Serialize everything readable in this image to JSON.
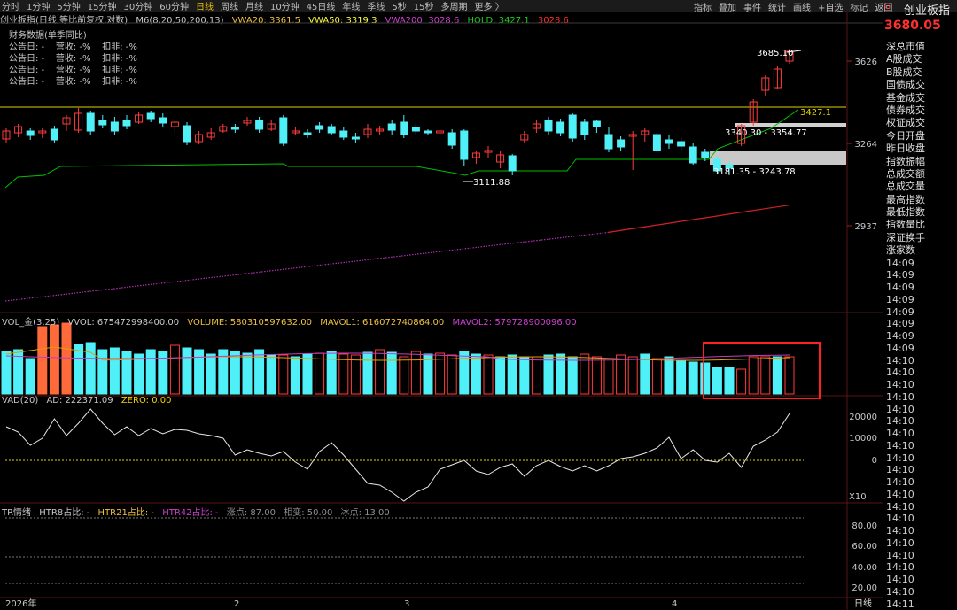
{
  "topbar": {
    "periods": [
      "分时",
      "1分钟",
      "5分钟",
      "15分钟",
      "30分钟",
      "60分钟",
      "日线",
      "周线",
      "月线",
      "10分钟",
      "45日线",
      "年线",
      "季线",
      "5秒",
      "15秒",
      "多周期",
      "更多 〉"
    ],
    "active": "日线",
    "right_menu": [
      "指标",
      "叠加",
      "事件",
      "统计",
      "画线",
      "+自选",
      "标记",
      "返回"
    ]
  },
  "stock": {
    "name": "创业板指",
    "price": "3680.05",
    "icon": "G"
  },
  "main_header": {
    "title": "创业板指(日线,等比前复权,对数)",
    "m6": "M6(8,20,50,200,13)",
    "vwa20": "VWA20: 3361.5",
    "vwa50": "VWA50: 3319.3",
    "vwa200": "VWA200: 3028.6",
    "hold": "HOLD: 3427.1",
    "last": "3028.6"
  },
  "financial": {
    "title": "财务数据(单季同比)",
    "rows": [
      "公告日: -    营收: -%    扣非: -%",
      "公告日: -    营收: -%    扣非: -%",
      "公告日: -    营收: -%    扣非: -%",
      "公告日: -    营收: -%    扣非: -%"
    ]
  },
  "price_axis": [
    "3626",
    "3264",
    "2937"
  ],
  "annotations": {
    "high": "3685.10",
    "hold": "3427.1",
    "zone1": "3340.30 - 3354.77",
    "zone2": "3181.35 - 3243.78",
    "low": "3111.88"
  },
  "vol_header": {
    "name": "VOL_金(3,25)",
    "vvol": "VVOL: 675472998400.00",
    "volume": "VOLUME: 580310597632.00",
    "mavol1": "MAVOL1: 616072740864.00",
    "mavol2": "MAVOL2: 579728900096.00"
  },
  "vad_header": {
    "name": "VAD(20)",
    "ad": "AD: 222371.09",
    "zero": "ZERO: 0.00"
  },
  "vad_axis": [
    "20000",
    "10000",
    "0"
  ],
  "tr_header": {
    "name": "TR情绪",
    "htr8": "HTR8占比: -",
    "htr21": "HTR21占比: -",
    "htr42": "HTR42占比: -",
    "rise": "涨点: 87.00",
    "flat": "相变: 50.00",
    "ice": "冰点: 13.00"
  },
  "tr_axis": [
    "80.00",
    "60.00",
    "40.00",
    "20.00"
  ],
  "x10": "X10",
  "xaxis": {
    "labels": [
      "2026年",
      "2",
      "3",
      "4"
    ],
    "period": "日线"
  },
  "sidebar": {
    "items": [
      "深总市值",
      "A股成交",
      "B股成交",
      "国债成交",
      "基金成交",
      "债券成交",
      "权证成交",
      "今日开盘",
      "昨日收盘",
      "指数振幅",
      "总成交额",
      "总成交量",
      "最高指数",
      "最低指数",
      "指数量比",
      "深证换手",
      "涨家数"
    ],
    "times": [
      "14:09",
      "14:09",
      "14:09",
      "14:09",
      "14:09",
      "14:09",
      "14:09",
      "14:09",
      "14:10",
      "14:10",
      "14:10",
      "14:10",
      "14:10",
      "14:10",
      "14:10",
      "14:10",
      "14:10",
      "14:10",
      "14:10",
      "14:10",
      "14:10",
      "14:10",
      "14:10",
      "14:10",
      "14:10",
      "14:10",
      "14:10",
      "14:10",
      "14:11"
    ]
  },
  "colors": {
    "up": "#ff3c3c",
    "down": "#4ff0f8",
    "vwa20": "#f0c040",
    "vwa50": "#ffff00",
    "vwa200": "#c030c0",
    "hold": "#00d000",
    "highlight": "#ff2020"
  }
}
